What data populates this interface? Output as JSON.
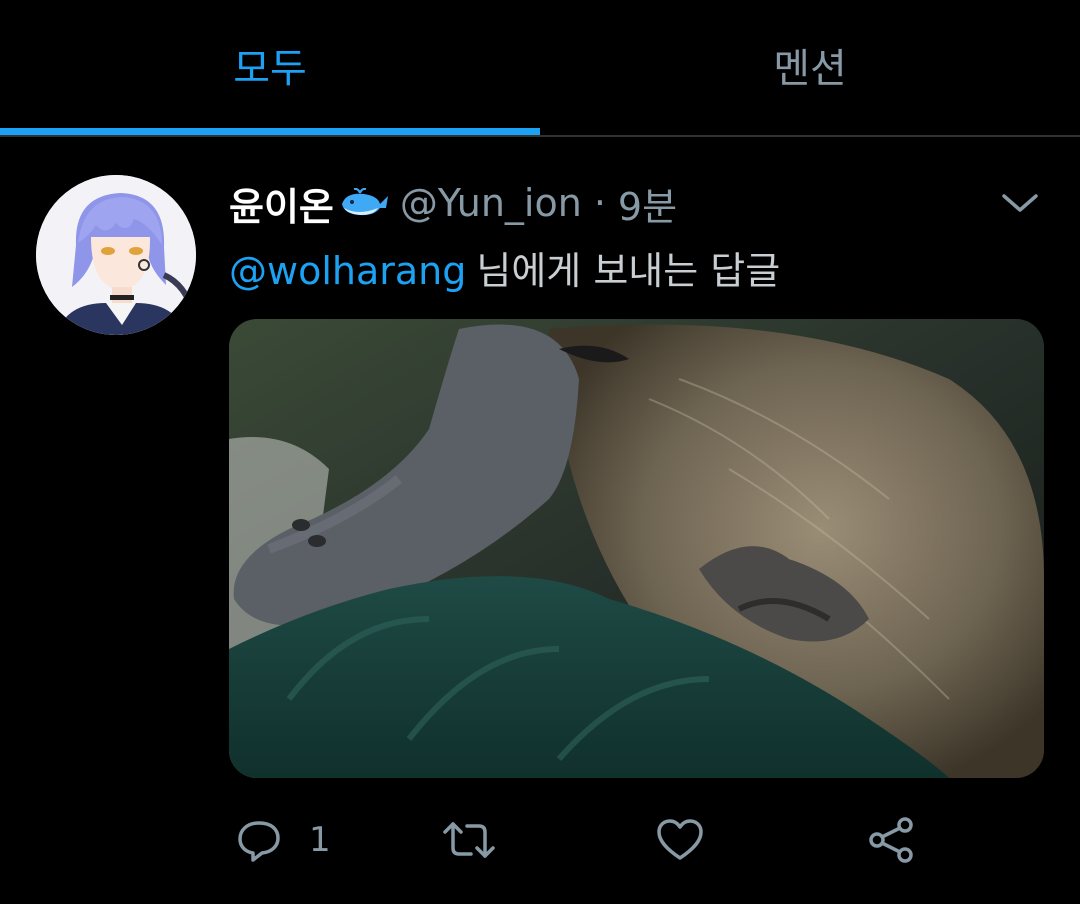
{
  "tabs": [
    {
      "label": "모두",
      "active": true
    },
    {
      "label": "멘션",
      "active": false
    }
  ],
  "colors": {
    "accent": "#1da1f2",
    "secondary_text": "#8899a6",
    "background": "#000000"
  },
  "tweet": {
    "display_name": "윤이온",
    "name_emoji": "whale-icon",
    "handle": "@Yun_ion",
    "separator": "·",
    "time": "9분",
    "reply_to_link": "@wolharang",
    "reply_suffix": "님에게 보내는 답글",
    "media": "photo of a platypus resting on a green cloth",
    "reply_count": "1"
  },
  "icons": [
    "chevron-down-icon",
    "reply-icon",
    "retweet-icon",
    "like-icon",
    "share-icon"
  ]
}
